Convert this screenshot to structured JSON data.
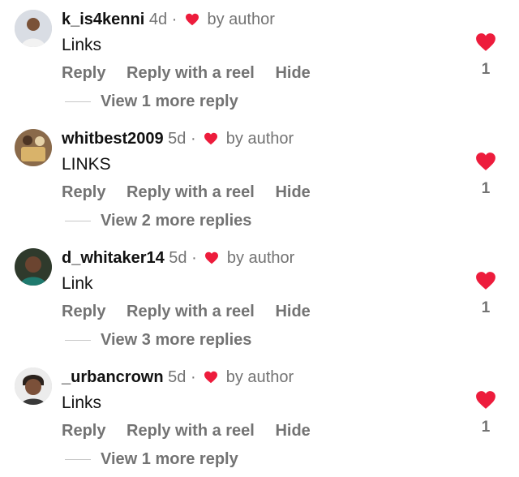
{
  "colors": {
    "heart": "#ED1C3C",
    "muted_text": "#737373",
    "primary_text": "#111111"
  },
  "comments": [
    {
      "username": "k_is4kenni",
      "time": "4d",
      "dot": "·",
      "liked_by": "by author",
      "text": "Links",
      "reply": "Reply",
      "reply_reel": "Reply with a reel",
      "hide": "Hide",
      "view_more": "View 1 more reply",
      "likes": "1",
      "avatar_icon": "avatar-icon"
    },
    {
      "username": "whitbest2009",
      "time": "5d",
      "dot": "·",
      "liked_by": "by author",
      "text": "LINKS",
      "reply": "Reply",
      "reply_reel": "Reply with a reel",
      "hide": "Hide",
      "view_more": "View 2 more replies",
      "likes": "1",
      "avatar_icon": "avatar-icon"
    },
    {
      "username": "d_whitaker14",
      "time": "5d",
      "dot": "·",
      "liked_by": "by author",
      "text": "Link",
      "reply": "Reply",
      "reply_reel": "Reply with a reel",
      "hide": "Hide",
      "view_more": "View 3 more replies",
      "likes": "1",
      "avatar_icon": "avatar-icon"
    },
    {
      "username": "_urbancrown",
      "time": "5d",
      "dot": "·",
      "liked_by": "by author",
      "text": "Links",
      "reply": "Reply",
      "reply_reel": "Reply with a reel",
      "hide": "Hide",
      "view_more": "View 1 more reply",
      "likes": "1",
      "avatar_icon": "avatar-icon"
    }
  ]
}
